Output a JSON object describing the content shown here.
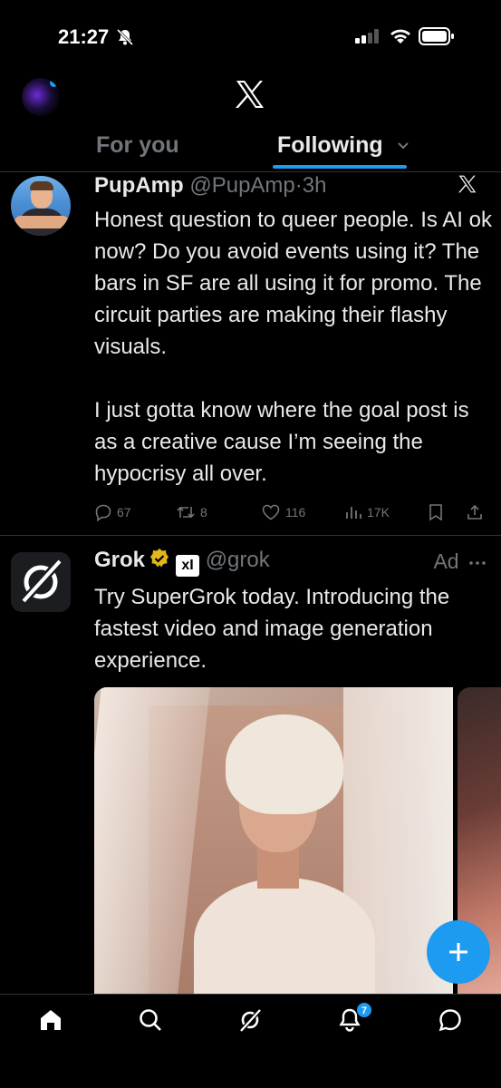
{
  "status_bar": {
    "time": "21:27"
  },
  "header": {
    "tabs": [
      {
        "label": "For you",
        "active": false
      },
      {
        "label": "Following",
        "active": true
      }
    ]
  },
  "posts": [
    {
      "name": "PupAmp",
      "handle": "@PupAmp",
      "separator": "·",
      "time": "3h",
      "text": "Honest question to queer people. Is AI ok now? Do you avoid events using it? The bars in SF are all using it for promo. The circuit parties are making their flashy visuals.\n\nI just gotta know where the goal post is as a creative cause I’m seeing the hypocrisy all over.",
      "stats": {
        "replies": "67",
        "reposts": "8",
        "likes": "116",
        "views": "17K"
      }
    },
    {
      "name": "Grok",
      "handle": "@grok",
      "ad_label": "Ad",
      "xai_label": "xI",
      "text": "Try SuperGrok today. Introducing the fastest video and image generation experience."
    }
  ],
  "bottom_nav": {
    "items": [
      "home-icon",
      "search-icon",
      "grok-icon",
      "bell-icon",
      "messages-icon"
    ],
    "notification_count": "7"
  },
  "colors": {
    "accent": "#1d9bf0",
    "background": "#000000",
    "text": "#e7e9ea",
    "muted": "#71767b",
    "border": "#2f3336"
  }
}
